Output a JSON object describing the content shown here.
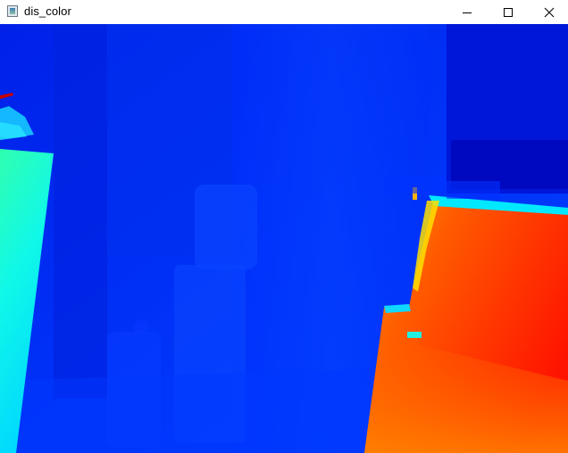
{
  "window": {
    "title": "dis_color"
  },
  "title_bar": {
    "icons": {
      "app": "app-icon",
      "minimize": "minimize-icon",
      "maximize": "maximize-icon",
      "close": "close-icon"
    }
  },
  "image_view": {
    "content": "colormap-depth-image",
    "colors": {
      "far": "#0010f0",
      "mid": "#00ffe0",
      "near": "#ff2a00"
    }
  }
}
